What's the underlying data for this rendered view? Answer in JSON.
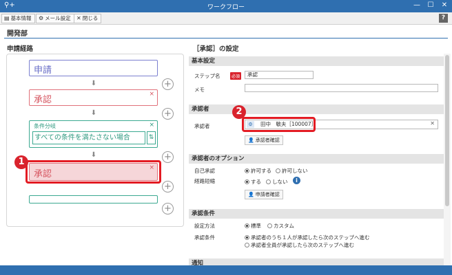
{
  "window": {
    "title": "ワークフロー",
    "min_icon": "—",
    "max_icon": "☐",
    "close_icon": "✕",
    "app_icon": "search-plus-icon"
  },
  "toolbar": {
    "basic_info": "基本情報",
    "mail_settings": "メール設定",
    "close": "閉じる",
    "help": "?"
  },
  "page": {
    "title": "開発部"
  },
  "flow": {
    "heading": "申請経路",
    "steps": {
      "apply": "申請",
      "approve1": "承認",
      "condition_title": "条件分岐",
      "condition_label": "すべての条件を満たさない場合",
      "approve2": "承認"
    },
    "badge1": "1",
    "close_mark": "×",
    "plus_mark": "+"
  },
  "settings": {
    "heading": "［承認］の設定",
    "basic": {
      "title": "基本設定",
      "step_name_label": "ステップ名",
      "required": "必須",
      "step_name_value": "承認",
      "memo_label": "メモ",
      "memo_value": ""
    },
    "approver": {
      "title": "承認者",
      "label": "承認者",
      "value": "田中　敏夫［100007］",
      "confirm_button": "承認者確認",
      "badge2": "2"
    },
    "options": {
      "title": "承認者のオプション",
      "self_approve_label": "自己承認",
      "self_allow": "許可する",
      "self_deny": "許可しない",
      "shortcut_label": "経路短縮",
      "shortcut_yes": "する",
      "shortcut_no": "しない",
      "applicant_confirm": "申請者確認"
    },
    "conditions": {
      "title": "承認条件",
      "method_label": "設定方法",
      "method_standard": "標準",
      "method_custom": "カスタム",
      "cond_label": "承認条件",
      "cond_one": "承認者のうち１人が承認したら次のステップへ進む",
      "cond_all": "承認者全員が承認したら次のステップへ進む"
    },
    "notify": {
      "title": "通知"
    }
  },
  "colors": {
    "accent": "#2f6fb0",
    "apply": "#7b7fd0",
    "approve": "#e0707a",
    "condition": "#3aa890",
    "highlight": "#e31b23"
  }
}
